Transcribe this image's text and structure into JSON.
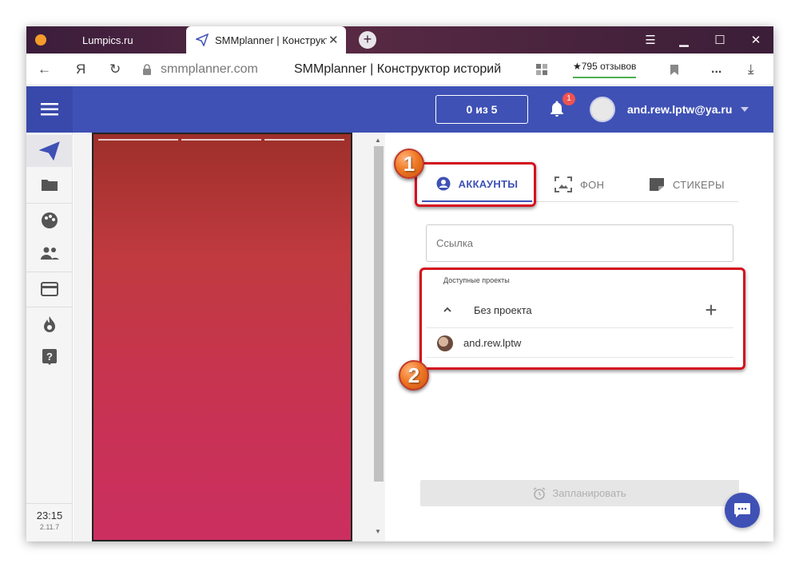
{
  "browser": {
    "tabs": [
      {
        "label": "Lumpics.ru"
      },
      {
        "label": "SMMplanner | Конструктор историй"
      }
    ],
    "url": "smmplanner.com",
    "page_title": "SMMplanner | Конструктор историй",
    "reviews": "★795 отзывов",
    "yandex_glyph": "Я",
    "more": "..."
  },
  "header": {
    "counter": "0 из 5",
    "notifications_count": "1",
    "user_email": "and.rew.lptw@ya.ru"
  },
  "sidebar": {
    "time": "23:15",
    "version": "2.11.7"
  },
  "panel": {
    "tabs": [
      {
        "label": "АККАУНТЫ"
      },
      {
        "label": "ФОН"
      },
      {
        "label": "СТИКЕРЫ"
      }
    ],
    "link_placeholder": "Ссылка",
    "projects_label": "Доступные проекты",
    "project_name": "Без проекта",
    "account_name": "and.rew.lptw",
    "schedule_label": "Запланировать"
  },
  "annotations": {
    "badge_1": "1",
    "badge_2": "2"
  },
  "colors": {
    "accent": "#3f51b5",
    "highlight": "#d40f1e",
    "badge": "#f07a26"
  }
}
